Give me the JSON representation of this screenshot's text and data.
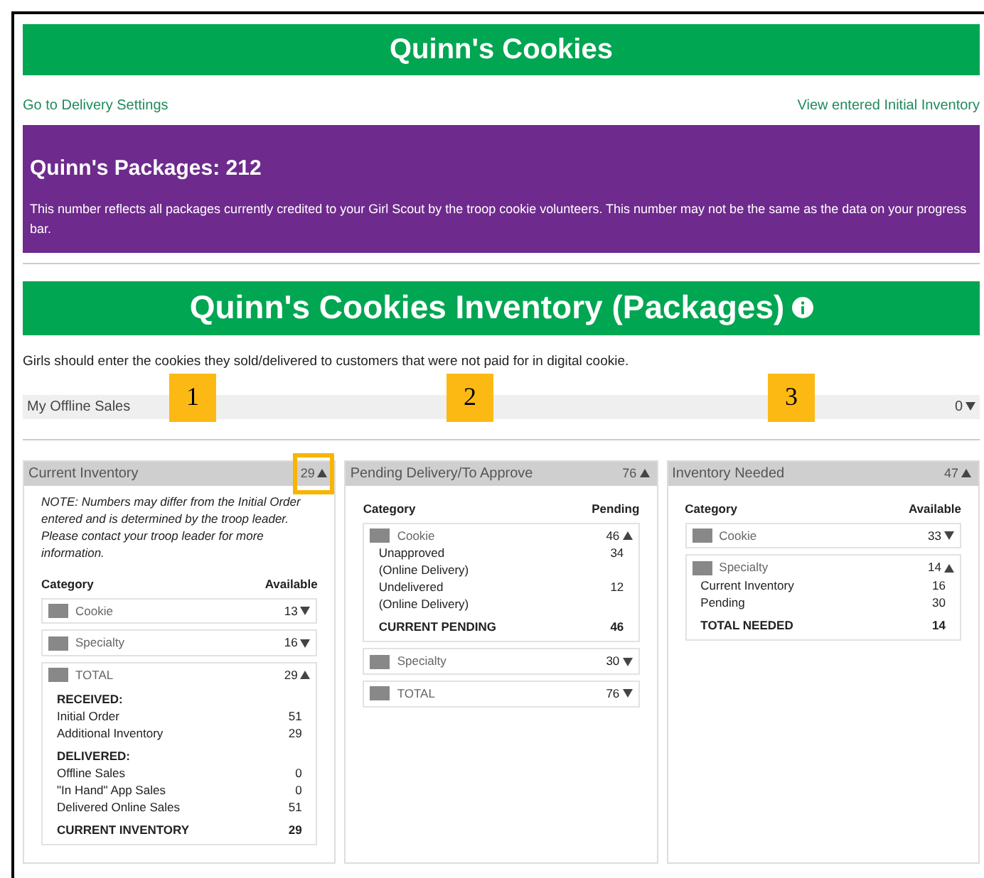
{
  "header": {
    "title": "Quinn's Cookies"
  },
  "links": [
    {
      "label": "Go to Delivery Settings"
    },
    {
      "label": "View entered Initial Inventory"
    }
  ],
  "packages": {
    "title": "Quinn's Packages: 212",
    "description": "This number reflects all packages currently credited to your Girl Scout by the troop cookie volunteers. This number may not be the same as the data on your progress bar."
  },
  "inventory": {
    "title": "Quinn's Cookies Inventory (Packages)",
    "instructions": "Girls should enter the cookies they sold/delivered to customers that were not paid for in digital cookie."
  },
  "offline_sales": {
    "label": "My Offline Sales",
    "value": "0",
    "expanded": false
  },
  "callouts": [
    "1",
    "2",
    "3"
  ],
  "panels": [
    {
      "title": "Current Inventory",
      "total": "29",
      "expanded": true,
      "highlighted": true,
      "note": "NOTE: Numbers may differ from the Initial Order entered and is determined by the troop leader. Please contact your troop leader for more information.",
      "columns": [
        "Category",
        "Available"
      ],
      "categories": [
        {
          "name": "Cookie",
          "value": "13",
          "expanded": false
        },
        {
          "name": "Specialty",
          "value": "16",
          "expanded": false
        },
        {
          "name": "TOTAL",
          "value": "29",
          "expanded": true,
          "details": [
            {
              "kind": "heading",
              "label": "RECEIVED:"
            },
            {
              "kind": "row",
              "label": "Initial Order",
              "value": "51"
            },
            {
              "kind": "row",
              "label": "Additional Inventory",
              "value": "29"
            },
            {
              "kind": "heading",
              "label": "DELIVERED:"
            },
            {
              "kind": "row",
              "label": "Offline Sales",
              "value": "0"
            },
            {
              "kind": "row",
              "label": "\"In Hand\" App Sales",
              "value": "0"
            },
            {
              "kind": "row",
              "label": "Delivered Online Sales",
              "value": "51"
            },
            {
              "kind": "total",
              "label": "CURRENT INVENTORY",
              "value": "29"
            }
          ]
        }
      ]
    },
    {
      "title": "Pending Delivery/To Approve",
      "total": "76",
      "expanded": true,
      "highlighted": false,
      "columns": [
        "Category",
        "Pending"
      ],
      "categories": [
        {
          "name": "Cookie",
          "value": "46",
          "expanded": true,
          "details": [
            {
              "kind": "row",
              "label": "Unapproved\n(Online Delivery)",
              "value": "34"
            },
            {
              "kind": "row",
              "label": "Undelivered\n(Online Delivery)",
              "value": "12"
            },
            {
              "kind": "total",
              "label": "CURRENT PENDING",
              "value": "46"
            }
          ]
        },
        {
          "name": "Specialty",
          "value": "30",
          "expanded": false
        },
        {
          "name": "TOTAL",
          "value": "76",
          "expanded": false
        }
      ]
    },
    {
      "title": "Inventory Needed",
      "total": "47",
      "expanded": true,
      "highlighted": false,
      "columns": [
        "Category",
        "Available"
      ],
      "categories": [
        {
          "name": "Cookie",
          "value": "33",
          "expanded": false
        },
        {
          "name": "Specialty",
          "value": "14",
          "expanded": true,
          "details": [
            {
              "kind": "row",
              "label": "Current Inventory",
              "value": "16"
            },
            {
              "kind": "row",
              "label": "Pending",
              "value": "30"
            },
            {
              "kind": "total",
              "label": "TOTAL NEEDED",
              "value": "14"
            }
          ]
        }
      ]
    }
  ]
}
